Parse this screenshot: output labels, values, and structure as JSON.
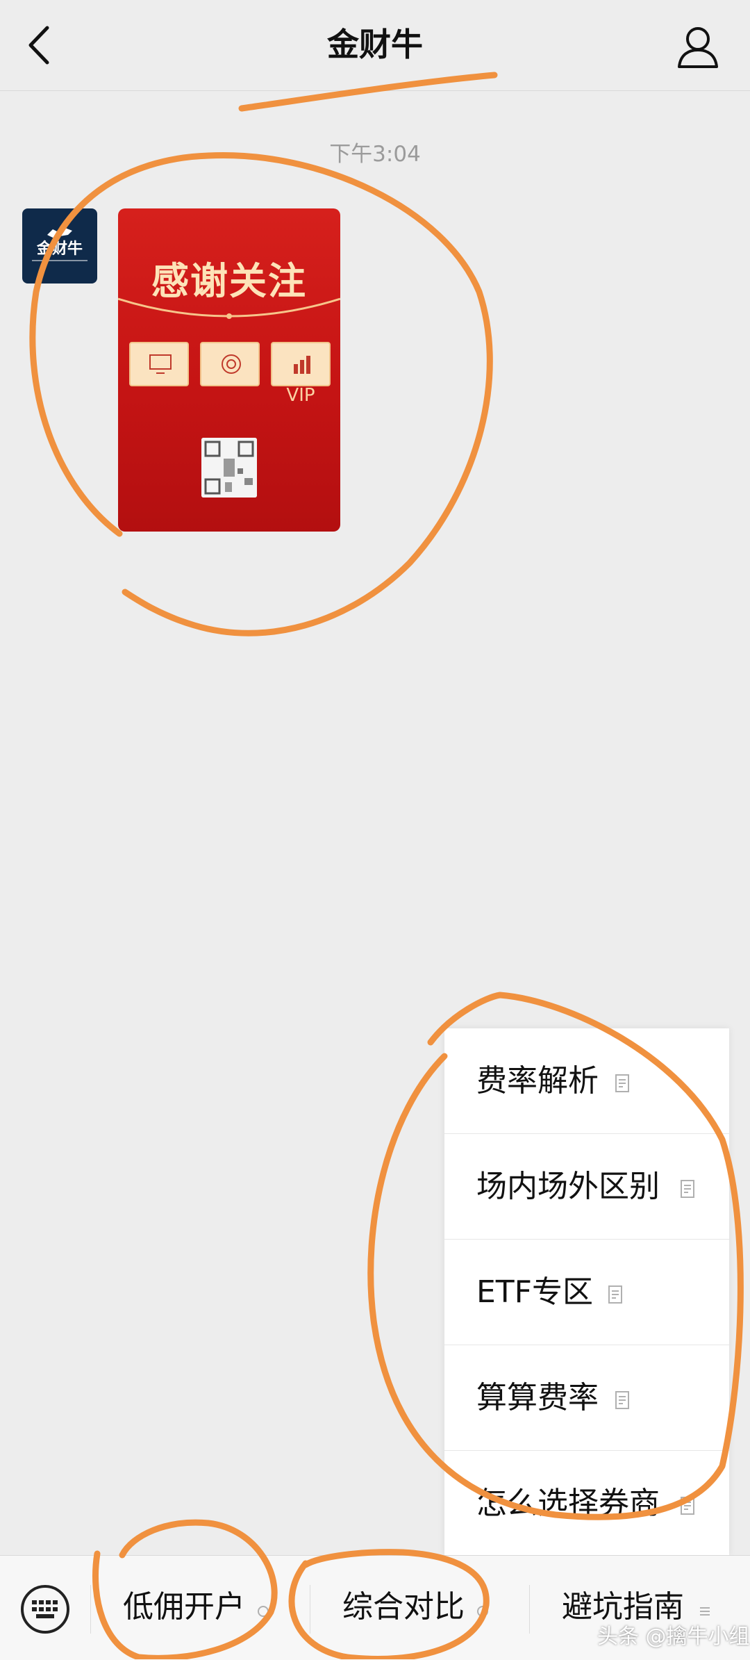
{
  "header": {
    "title": "金财牛",
    "back_icon": "chevron-left-icon",
    "profile_icon": "person-icon"
  },
  "chat": {
    "timestamp": "下午3:04",
    "avatar_text": "金财牛",
    "poster": {
      "title": "感谢关注",
      "icon_labels": [
        "",
        "",
        "VIP"
      ],
      "footer": ""
    }
  },
  "popup_menu": {
    "items": [
      {
        "label": "费率解析",
        "icon": "document-icon"
      },
      {
        "label": "场内场外区别",
        "icon": "document-icon"
      },
      {
        "label": "ETF专区",
        "icon": "document-icon"
      },
      {
        "label": "算算费率",
        "icon": "document-icon"
      },
      {
        "label": "怎么选择券商",
        "icon": "document-icon"
      }
    ]
  },
  "bottom_bar": {
    "keyboard_icon": "keyboard-icon",
    "tabs": [
      {
        "label": "低佣开户"
      },
      {
        "label": "综合对比"
      },
      {
        "label": "避坑指南"
      }
    ]
  },
  "watermark": "头条 @擒牛小组",
  "colors": {
    "background": "#ededed",
    "poster_red": "#c51414",
    "annotation_orange": "#f0913f"
  }
}
